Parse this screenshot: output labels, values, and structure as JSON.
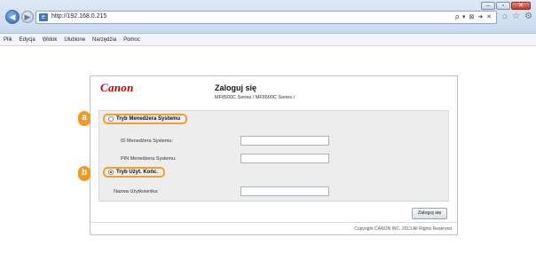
{
  "browser": {
    "url": "http://192.168.0.215",
    "window_controls": [
      "–",
      "▫",
      "✕"
    ],
    "address_tools": "ρ ▾ ⊠ ➜ ✕",
    "menu": [
      "Plik",
      "Edycja",
      "Widok",
      "Ulubione",
      "Narzędzia",
      "Pomoc"
    ]
  },
  "panel": {
    "logo": "Canon",
    "title": "Zaloguj się",
    "subtitle": "MF8500C Series / MF8500C Series /",
    "system_manager_mode": "Tryb Menedżera Systemu",
    "system_manager_id_label": "ID Menedżera Systemu:",
    "system_manager_pin_label": "PIN Menedżera Systemu:",
    "user_mode": "Tryb Użyt. Końc.",
    "username_label": "Nazwa Użytkownika:",
    "login_button": "Zaloguj się",
    "copyright": "Copyright CANON INC. 2013 All Rights Reserved"
  },
  "callouts": {
    "a": "a",
    "b": "b"
  },
  "colors": {
    "accent": "#f09a21",
    "logo": "#cc0000"
  }
}
